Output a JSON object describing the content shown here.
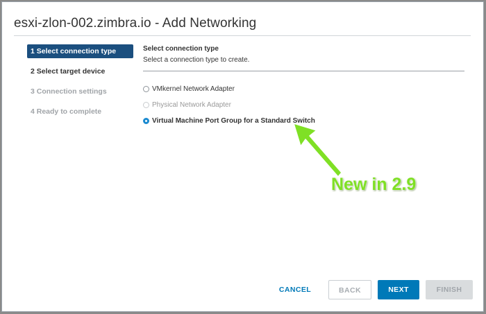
{
  "dialog": {
    "title": "esxi-zlon-002.zimbra.io - Add Networking"
  },
  "wizard": {
    "steps": [
      {
        "label": "1 Select connection type",
        "state": "active"
      },
      {
        "label": "2 Select target device",
        "state": "enabled"
      },
      {
        "label": "3 Connection settings",
        "state": "disabled"
      },
      {
        "label": "4 Ready to complete",
        "state": "disabled"
      }
    ]
  },
  "main": {
    "section_title": "Select connection type",
    "section_desc": "Select a connection type to create.",
    "options": [
      {
        "label": "VMkernel Network Adapter",
        "state": "unchecked"
      },
      {
        "label": "Physical Network Adapter",
        "state": "disabled"
      },
      {
        "label": "Virtual Machine Port Group for a Standard Switch",
        "state": "checked"
      }
    ]
  },
  "annotation": {
    "text": "New in 2.9",
    "color": "#7fe025"
  },
  "buttons": {
    "cancel": "CANCEL",
    "back": "BACK",
    "next": "NEXT",
    "finish": "FINISH"
  },
  "colors": {
    "active_step_bg": "#1b4f7f",
    "primary": "#0079b8",
    "radio_checked": "#1b8ad0"
  }
}
